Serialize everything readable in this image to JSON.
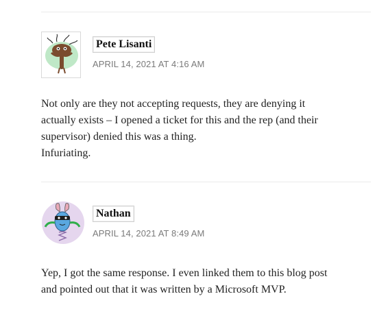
{
  "comments": [
    {
      "author": "Pete Lisanti",
      "date": "APRIL 14, 2021 AT 4:16 AM",
      "avatar_icon": "identicon-creature-icon",
      "avatar_color": "#bfe8c7",
      "body_lines": [
        "Not only are they not accepting requests, they are denying it",
        "actually exists – I opened a ticket for this and the rep (and their",
        "supervisor) denied this was a thing.",
        "Infuriating."
      ]
    },
    {
      "author": "Nathan",
      "date": "APRIL 14, 2021 AT 8:49 AM",
      "avatar_icon": "identicon-monster-icon",
      "avatar_color": "#e5d6ee",
      "body_lines": [
        "Yep, I got the same response. I even linked them to this blog post",
        "and pointed out that it was written by a Microsoft MVP."
      ]
    }
  ]
}
